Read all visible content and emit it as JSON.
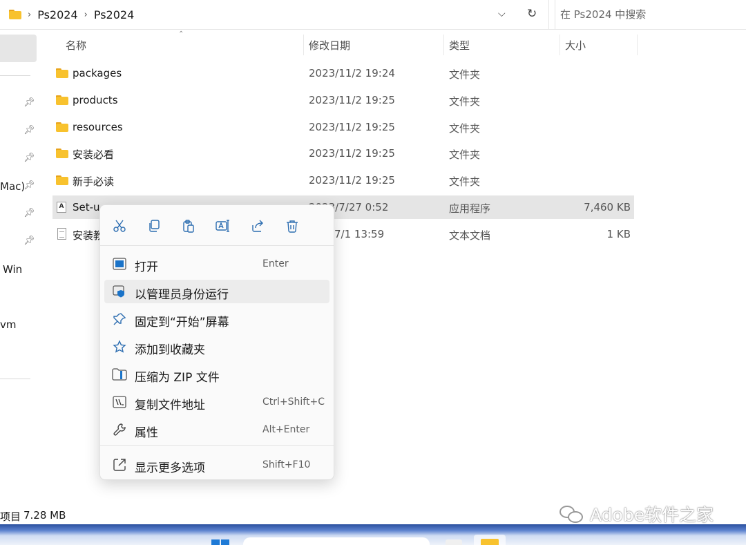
{
  "address": {
    "breadcrumb": [
      "Ps2024",
      "Ps2024"
    ],
    "search_placeholder": "在 Ps2024 中搜索"
  },
  "nav": {
    "partial_labels": [
      "Mac)",
      "Win",
      "vm"
    ]
  },
  "columns": {
    "name": "名称",
    "date": "修改日期",
    "type": "类型",
    "size": "大小"
  },
  "files": [
    {
      "name": "packages",
      "date": "2023/11/2 19:24",
      "type": "文件夹",
      "size": "",
      "icon": "folder-icon"
    },
    {
      "name": "products",
      "date": "2023/11/2 19:25",
      "type": "文件夹",
      "size": "",
      "icon": "folder-icon"
    },
    {
      "name": "resources",
      "date": "2023/11/2 19:25",
      "type": "文件夹",
      "size": "",
      "icon": "folder-icon"
    },
    {
      "name": "安装必看",
      "date": "2023/11/2 19:25",
      "type": "文件夹",
      "size": "",
      "icon": "folder-icon"
    },
    {
      "name": "新手必读",
      "date": "2023/11/2 19:25",
      "type": "文件夹",
      "size": "",
      "icon": "folder-icon"
    },
    {
      "name": "Set-u",
      "date": "2023/7/27 0:52",
      "type": "应用程序",
      "size": "7,460 KB",
      "icon": "app-icon",
      "selected": true
    },
    {
      "name": "安装教",
      "date": "7/1 13:59",
      "type": "文本文档",
      "size": "1 KB",
      "icon": "text-file-icon"
    }
  ],
  "status": {
    "count": "项目",
    "size": "7.28 MB"
  },
  "watermark": "Adobe软件之家",
  "context_menu": {
    "toolbar": [
      "cut-icon",
      "copy-icon",
      "paste-icon",
      "rename-icon",
      "share-icon",
      "delete-icon"
    ],
    "items": [
      {
        "label": "打开",
        "shortcut": "Enter",
        "icon": "open-icon"
      },
      {
        "label": "以管理员身份运行",
        "shortcut": "",
        "icon": "shield-icon",
        "hover": true
      },
      {
        "label": "固定到“开始”屏幕",
        "shortcut": "",
        "icon": "pin-icon"
      },
      {
        "label": "添加到收藏夹",
        "shortcut": "",
        "icon": "star-icon"
      },
      {
        "label": "压缩为 ZIP 文件",
        "shortcut": "",
        "icon": "zip-icon"
      },
      {
        "label": "复制文件地址",
        "shortcut": "Ctrl+Shift+C",
        "icon": "copy-path-icon"
      },
      {
        "label": "属性",
        "shortcut": "Alt+Enter",
        "icon": "wrench-icon"
      },
      {
        "label": "显示更多选项",
        "shortcut": "Shift+F10",
        "icon": "more-options-icon"
      }
    ]
  },
  "colors": {
    "accent": "#1a73c8",
    "folder": "#f8c22e",
    "selection": "#e5e5e5"
  }
}
